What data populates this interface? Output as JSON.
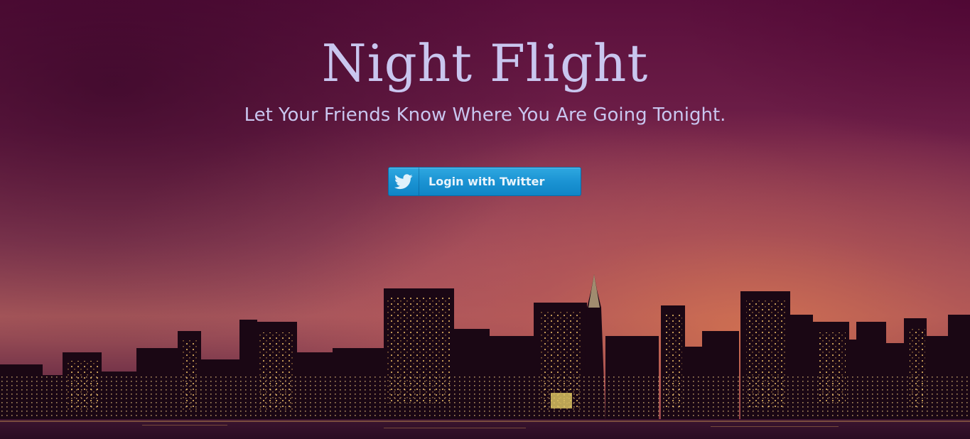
{
  "page": {
    "title": "Night Flight",
    "subtitle": "Let Your Friends Know Where You Are Going Tonight."
  },
  "login": {
    "label": "Login with Twitter",
    "icon": "twitter-bird-icon"
  },
  "colors": {
    "title_text": "#c9c6ef",
    "button_blue": "#1b93d3",
    "sky_top": "#5a0f3c",
    "sky_glow": "#d67450"
  },
  "background": {
    "scene": "city-skyline-at-dusk"
  }
}
